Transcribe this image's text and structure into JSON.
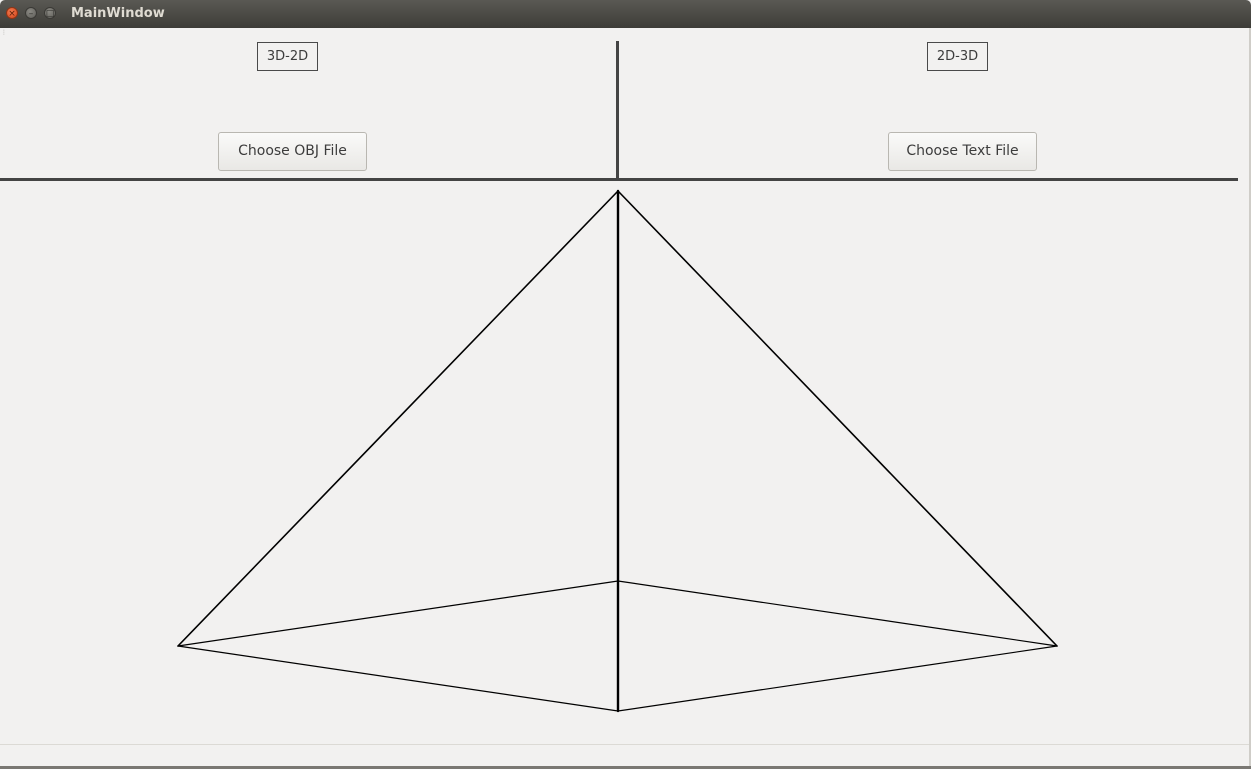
{
  "window": {
    "title": "MainWindow",
    "controls": {
      "close_glyph": "×",
      "minimize_glyph": "–",
      "maximize_glyph": "□"
    }
  },
  "left_panel": {
    "label": "3D-2D",
    "button_label": "Choose OBJ File"
  },
  "right_panel": {
    "label": "2D-3D",
    "button_label": "Choose Text File"
  },
  "colors": {
    "window_background": "#f2f1f0",
    "titlebar": "#3d3c38",
    "line_color": "#000000",
    "close_button": "#e0531f"
  },
  "canvas": {
    "drawing": "pyramid-wireframe"
  }
}
